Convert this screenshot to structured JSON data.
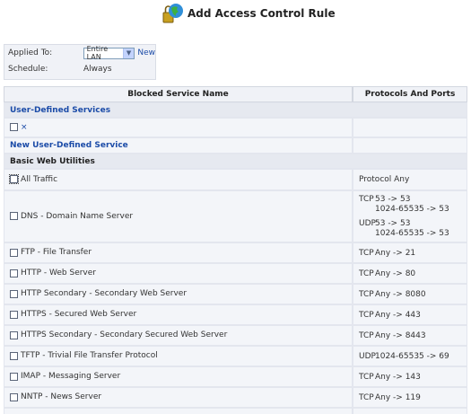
{
  "page": {
    "title": "Add Access Control Rule"
  },
  "applied_to": {
    "label": "Applied To:",
    "value": "Entire LAN",
    "new_link": "New"
  },
  "schedule": {
    "label": "Schedule:",
    "value": "Always"
  },
  "table": {
    "col_name": "Blocked Service Name",
    "col_ports": "Protocols And Ports",
    "user_defined_header": "User-Defined Services",
    "new_service_link": "New User-Defined Service",
    "basic_header": "Basic Web Utilities",
    "x_mark": "×",
    "services": [
      {
        "name": "All Traffic",
        "ports": "Protocol Any"
      },
      {
        "name": "DNS - Domain Name Server"
      },
      {
        "name": "FTP - File Transfer",
        "proto": "TCP",
        "range": "Any -> 21"
      },
      {
        "name": "HTTP - Web Server",
        "proto": "TCP",
        "range": "Any -> 80"
      },
      {
        "name": "HTTP Secondary - Secondary Web Server",
        "proto": "TCP",
        "range": "Any -> 8080"
      },
      {
        "name": "HTTPS - Secured Web Server",
        "proto": "TCP",
        "range": "Any -> 443"
      },
      {
        "name": "HTTPS Secondary - Secondary Secured Web Server",
        "proto": "TCP",
        "range": "Any -> 8443"
      },
      {
        "name": "TFTP - Trivial File Transfer Protocol",
        "proto": "UDP",
        "range": "1024-65535 -> 69"
      },
      {
        "name": "IMAP - Messaging Server",
        "proto": "TCP",
        "range": "Any -> 143"
      },
      {
        "name": "NNTP - News Server",
        "proto": "TCP",
        "range": "Any -> 119"
      }
    ],
    "dns": {
      "tcp": "TCP",
      "tcp_r1": "53 -> 53",
      "tcp_r2": "1024-65535 -> 53",
      "udp": "UDP",
      "udp_r1": "53 -> 53",
      "udp_r2": "1024-65535 -> 53"
    }
  }
}
